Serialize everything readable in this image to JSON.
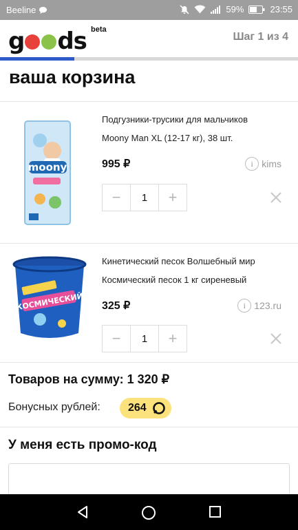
{
  "status_bar": {
    "carrier": "Beeline",
    "battery": "59%",
    "time": "23:55"
  },
  "header": {
    "logo_left": "g",
    "logo_right": "ds",
    "logo_dot_colors": [
      "#e8413b",
      "#8bc34a"
    ],
    "beta": "beta",
    "step": "Шаг 1 из 4",
    "progress": 0.25
  },
  "page_title": "ваша корзина",
  "cart_items": [
    {
      "name_line1": "Подгузники-трусики для мальчиков",
      "name_line2": "Moony Man XL (12-17 кг), 38 шт.",
      "price": "995 ₽",
      "seller": "kims",
      "quantity": "1",
      "minus": "−",
      "plus": "+"
    },
    {
      "name_line1": "Кинетический песок Волшебный мир",
      "name_line2": "Космический песок 1 кг сиреневый",
      "price": "325 ₽",
      "seller": "123.ru",
      "quantity": "1",
      "minus": "−",
      "plus": "+"
    }
  ],
  "summary": {
    "total": "Товаров на сумму: 1 320 ₽",
    "bonus_label": "Бонусных рублей:",
    "bonus_value": "264"
  },
  "promo": {
    "title": "У меня есть промо-код",
    "placeholder": ""
  },
  "icons": {
    "info": "i",
    "remove": "close-icon",
    "nav": [
      "back-icon",
      "home-icon",
      "recents-icon"
    ]
  },
  "colors": {
    "accent": "#2e5bc9",
    "bonus_pill": "#fce27c",
    "status_bar": "#9e9e9e"
  }
}
